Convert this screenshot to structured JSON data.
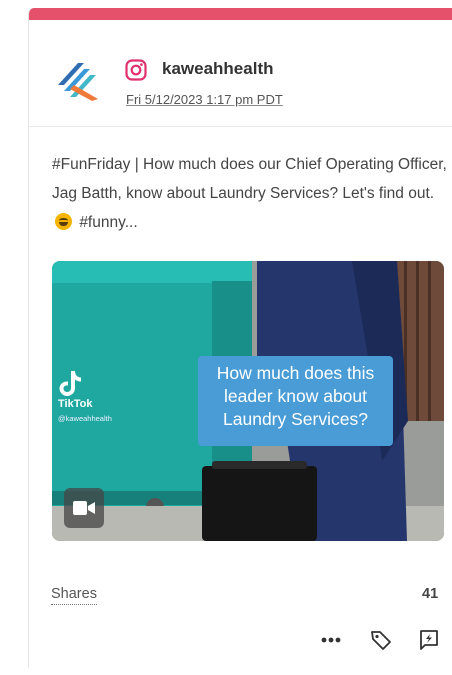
{
  "post": {
    "account": "kaweahhealth",
    "timestamp": "Fri 5/12/2023 1:17 pm PDT",
    "network_icon": "instagram-icon",
    "text_before_emoji": "#FunFriday | How much does our Chief Operating Officer, Jag Batth, know about Laundry Services? Let's find out.",
    "emoji": "laughing-emoji",
    "text_after_emoji": "#funny..."
  },
  "media": {
    "type": "video",
    "caption": "How much does this leader know about Laundry Services?",
    "watermark": "TikTok",
    "handle": "@kaweahhealth"
  },
  "metrics": {
    "shares_label": "Shares",
    "shares_value": "41"
  },
  "actions": [
    "more-icon",
    "tag-icon",
    "comment-icon"
  ],
  "colors": {
    "accent": "#e5506b",
    "instagram": "#e1306c",
    "caption_bg": "#4a9cd6"
  }
}
